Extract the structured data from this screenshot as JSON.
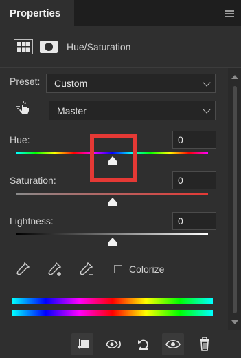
{
  "tab": {
    "title": "Properties"
  },
  "header": {
    "title": "Hue/Saturation"
  },
  "preset": {
    "label": "Preset:",
    "value": "Custom"
  },
  "channel": {
    "value": "Master"
  },
  "hue": {
    "label": "Hue:",
    "value": "0"
  },
  "saturation": {
    "label": "Saturation:",
    "value": "0"
  },
  "lightness": {
    "label": "Lightness:",
    "value": "0"
  },
  "colorize": {
    "label": "Colorize",
    "checked": false
  },
  "icons": {
    "panel_menu": "hamburger-icon",
    "adjustment": "adjustment-grid-icon",
    "mask": "mask-icon",
    "targeted_adjust": "hand-pointer-icon",
    "eyedropper": "eyedropper-icon",
    "eyedropper_add": "eyedropper-plus-icon",
    "eyedropper_subtract": "eyedropper-minus-icon",
    "clip": "clip-to-layer-icon",
    "view_previous": "view-previous-icon",
    "reset": "reset-icon",
    "visibility": "eye-icon",
    "delete": "trash-icon"
  },
  "colors": {
    "highlight": "#e53935",
    "panel_bg": "#2f2f2f",
    "field_bg": "#252525"
  }
}
